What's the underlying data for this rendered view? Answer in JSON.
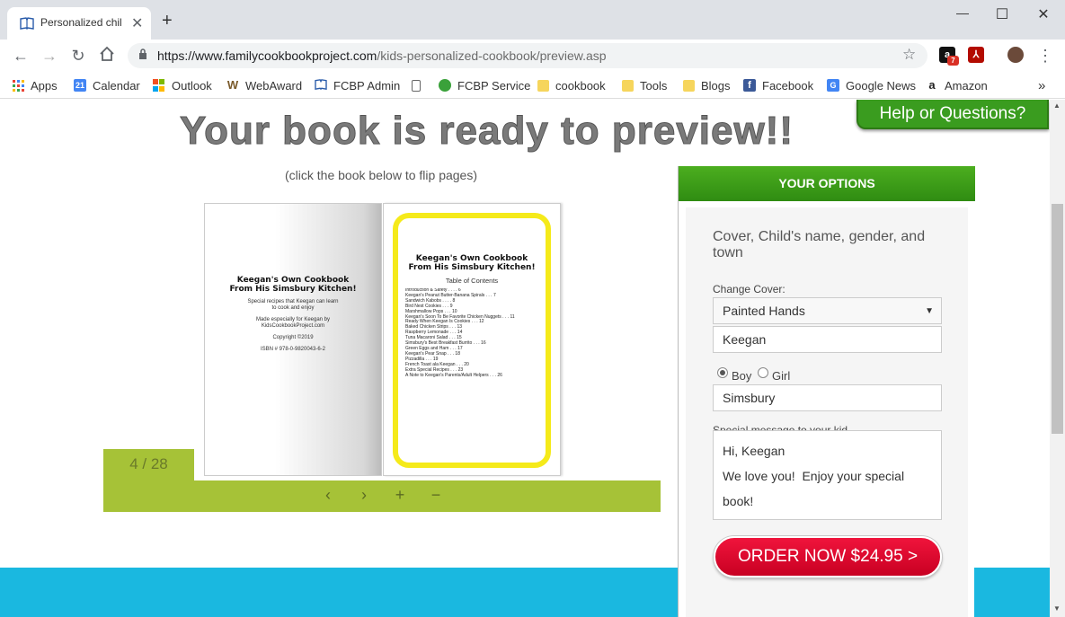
{
  "browser": {
    "tab_title": "Personalized chil",
    "tab_close": "✕",
    "new_tab": "+",
    "window_min": "—",
    "window_max": "☐",
    "window_close": "✕",
    "url_domain": "https://www.familycookbookproject.com",
    "url_path": "/kids-personalized-cookbook/preview.asp",
    "ext_badge": "7",
    "bookmarks": [
      {
        "label": "Apps",
        "icon": "apps-icon",
        "color": "#ea4335"
      },
      {
        "label": "Calendar",
        "icon": "calendar-icon",
        "color": "#4285f4",
        "glyph": "21"
      },
      {
        "label": "Outlook",
        "icon": "microsoft-icon",
        "color": "#f25022"
      },
      {
        "label": "WebAward",
        "icon": "webaward-icon",
        "color": "#7a5a2a",
        "glyph": "W"
      },
      {
        "label": "FCBP Admin",
        "icon": "book-icon",
        "color": "#2a5caa"
      },
      {
        "label": "",
        "icon": "page-icon",
        "color": "#ffffff"
      },
      {
        "label": "FCBP Service",
        "icon": "chat-icon",
        "color": "#3aa13a"
      },
      {
        "label": "cookbook",
        "icon": "folder-icon",
        "color": "#f6d55c"
      },
      {
        "label": "Tools",
        "icon": "folder-icon",
        "color": "#f6d55c"
      },
      {
        "label": "Blogs",
        "icon": "folder-icon",
        "color": "#f6d55c"
      },
      {
        "label": "Facebook",
        "icon": "facebook-icon",
        "color": "#3b5998",
        "glyph": "f"
      },
      {
        "label": "Google News",
        "icon": "google-news-icon",
        "color": "#4285f4",
        "glyph": "G"
      },
      {
        "label": "Amazon",
        "icon": "amazon-icon",
        "color": "#222222",
        "glyph": "a"
      }
    ],
    "bookmarks_more": "»"
  },
  "page": {
    "headline": "Your book is ready to preview!!",
    "help_button": "Help or Questions?",
    "flip_note": "(click the book below to flip pages)",
    "book": {
      "left_title": "Keegan's Own Cookbook\nFrom His Simsbury Kitchen!",
      "left_lines": [
        "Special recipes that Keegan can learn",
        "to cook and enjoy",
        "",
        "Made especially for Keegan by",
        "KidsCookbookProject.com",
        "",
        "Copyright ©2019",
        "",
        "ISBN # 978-0-9820043-6-2"
      ],
      "right_title": "Keegan's Own Cookbook\nFrom His Simsbury Kitchen!",
      "toc_title": "Table of Contents",
      "toc": [
        "Introduction & Safety . . . . 6",
        "Keegan's Peanut Butter-Banana Spirals . . . 7",
        "Sandwich Kabobs . . . . 8",
        "Bird Nest Cookies . . . 9",
        "Marshmallow Pops . . . 10",
        "Keegan's Soon To Be Favorite Chicken Nuggets . . . 11",
        "Ready When Keegan Is Cookies . . . 12",
        "Baked Chicken Strips . . . 13",
        "Raspberry Lemonade . . . 14",
        "Tuna Macaroni Salad . . . 15",
        "Simsbury's Best Breakfast Burrito . . . 16",
        "Green Eggs and Ham . . . 17",
        "Keegan's Pear Snap . . . 18",
        "Pizzadilla . . . 19",
        "French Toast ala Keegan . . . 20",
        "Extra Special Recipes . . . 23",
        "A Note to Keegan's Parents/Adult Helpers . . . 26"
      ]
    },
    "page_counter": "4 / 28",
    "controls": {
      "prev": "‹",
      "next": "›",
      "zoom_in": "+",
      "zoom_out": "−"
    }
  },
  "options": {
    "header": "YOUR OPTIONS",
    "heading": "Cover, Child's name, gender, and town",
    "change_cover_label": "Change Cover:",
    "cover_value": "Painted Hands",
    "child_name": "Keegan",
    "gender_boy": "Boy",
    "gender_girl": "Girl",
    "town": "Simsbury",
    "message_label": "Special message to your kid",
    "message": "Hi, Keegan\nWe love you!  Enjoy your special book!",
    "order_button": "ORDER NOW $24.95 >"
  },
  "colors": {
    "accent_green": "#3a9c1f",
    "flip_bar": "#a6c237",
    "order_red": "#e8102f",
    "footer_blue": "#1ab8e0",
    "frame_yellow": "#f5ea1a"
  }
}
